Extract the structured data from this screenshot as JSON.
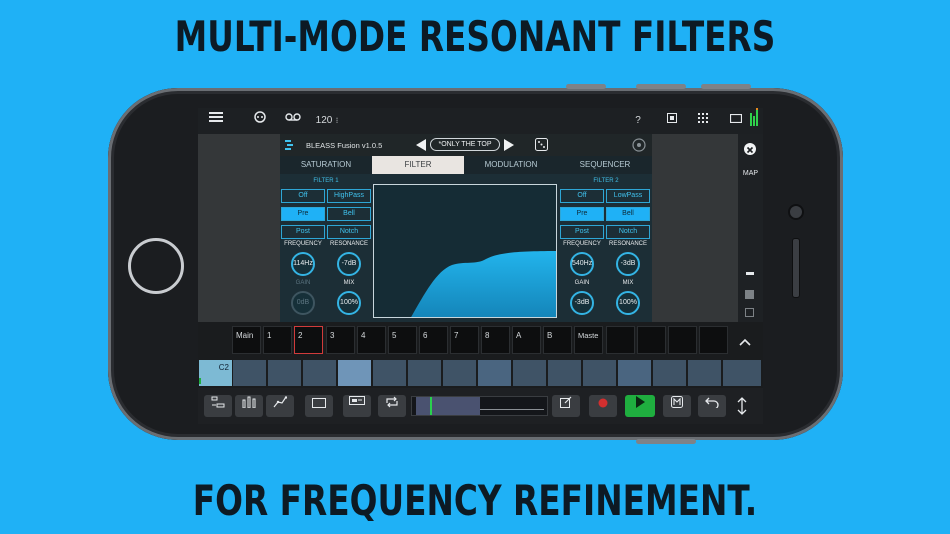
{
  "headlines": {
    "top": "MULTI-MODE RESONANT FILTERS",
    "bottom": "FOR FREQUENCY REFINEMENT."
  },
  "topbar": {
    "menu_icon": "hamburger-icon",
    "link_icon": "link-icon",
    "tape_icon": "tape-icon",
    "tempo": "120",
    "help": "?"
  },
  "plugin": {
    "name": "BLEASS Fusion v1.0.5",
    "preset": "*ONLY THE TOP",
    "tabs": [
      "SATURATION",
      "FILTER",
      "MODULATION",
      "SEQUENCER"
    ],
    "active_tab": "FILTER",
    "filter1": {
      "title": "FILTER 1",
      "buttons": [
        "Off",
        "HighPass",
        "Pre",
        "Bell",
        "Post",
        "Notch"
      ],
      "labels": {
        "frequency": "FREQUENCY",
        "resonance": "RESONANCE",
        "gain": "GAIN",
        "mix": "MIX"
      },
      "values": {
        "frequency": "114Hz",
        "resonance": "-7dB",
        "gain": "0dB",
        "mix": "100%"
      }
    },
    "filter2": {
      "title": "FILTER 2",
      "buttons": [
        "Off",
        "LowPass",
        "Pre",
        "Bell",
        "Post",
        "Notch"
      ],
      "labels": {
        "frequency": "FREQUENCY",
        "resonance": "RESONANCE",
        "gain": "GAIN",
        "mix": "MIX"
      },
      "values": {
        "frequency": "540Hz",
        "resonance": "-3dB",
        "gain": "-3dB",
        "mix": "100%"
      }
    }
  },
  "side": {
    "map": "MAP"
  },
  "tracks": [
    "Main",
    "1",
    "2",
    "3",
    "4",
    "5",
    "6",
    "7",
    "8",
    "A",
    "B",
    "Maste"
  ],
  "selected_track": "2",
  "pad_label": "C2",
  "colors": {
    "accent": "#1fb1f6",
    "play": "#1fae3f",
    "record": "#d32f2f"
  }
}
